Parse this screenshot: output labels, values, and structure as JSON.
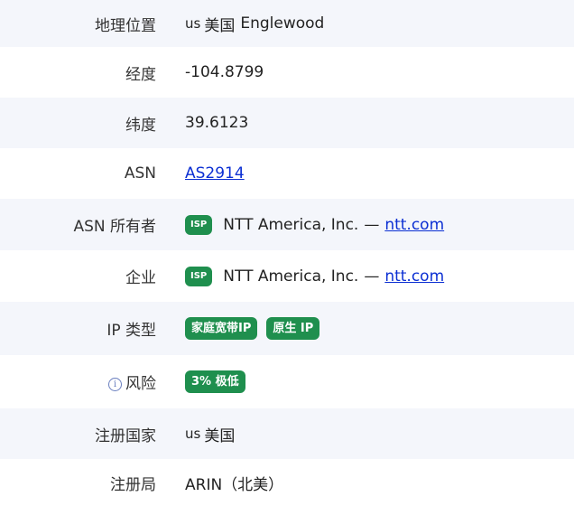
{
  "rows": [
    {
      "label": "地理位置",
      "cc": "us",
      "country": "美国",
      "city": "Englewood"
    },
    {
      "label": "经度",
      "value": "-104.8799"
    },
    {
      "label": "纬度",
      "value": "39.6123"
    },
    {
      "label": "ASN",
      "link": "AS2914"
    },
    {
      "label": "ASN 所有者",
      "badge": "ISP",
      "org": "NTT America, Inc.",
      "sep": "—",
      "link": "ntt.com"
    },
    {
      "label": "企业",
      "badge": "ISP",
      "org": "NTT America, Inc.",
      "sep": "—",
      "link": "ntt.com"
    },
    {
      "label": "IP 类型",
      "badges": [
        "家庭宽带IP",
        "原生 IP"
      ]
    },
    {
      "label": "风险",
      "info_icon": "info-icon",
      "badge": "3% 极低"
    },
    {
      "label": "注册国家",
      "cc": "us",
      "country": "美国"
    },
    {
      "label": "注册局",
      "value": "ARIN（北美）"
    }
  ],
  "colors": {
    "alt_row": "#f4f6fb",
    "badge": "#1f8f4e",
    "link": "#0b2fd3"
  }
}
